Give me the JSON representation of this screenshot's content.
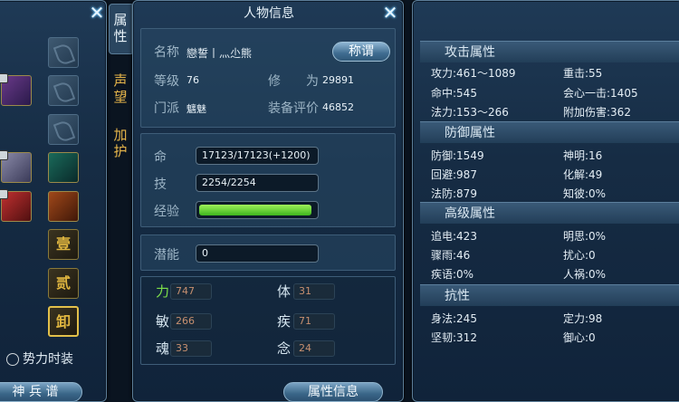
{
  "equipment": {
    "close_glyph": "✕",
    "runes": [
      "壹",
      "贰",
      "卸"
    ],
    "checkbox_label": "势力时装",
    "bottom_button": "神 兵 谱"
  },
  "tabs": {
    "attr": "属性",
    "fame": "声望",
    "protect": "加护"
  },
  "info": {
    "title": "人物信息",
    "close_glyph": "✕",
    "name_label": "名称",
    "name_value": "戀誓丨灬尐熊",
    "title_button": "称谓",
    "level_label": "等级",
    "level_value": "76",
    "xiu_label": "修",
    "wei_label": "为",
    "xiu_value": "29891",
    "sect_label": "门派",
    "sect_value": "魑魅",
    "rating_label": "装备评价",
    "rating_value": "46852",
    "hp_label": "命",
    "hp_value": "17123/17123(+1200)",
    "skill_label": "技",
    "skill_value": "2254/2254",
    "exp_label": "经验",
    "exp_fraction": 0.97,
    "potential_label": "潜能",
    "potential_value": "0",
    "stats": [
      {
        "label": "力",
        "value": "747"
      },
      {
        "label": "体",
        "value": "31"
      },
      {
        "label": "敏",
        "value": "266"
      },
      {
        "label": "疾",
        "value": "71"
      },
      {
        "label": "魂",
        "value": "33"
      },
      {
        "label": "念",
        "value": "24"
      }
    ],
    "bottom_button": "属性信息"
  },
  "props": {
    "attack_head": "攻击属性",
    "attack": [
      "攻力:461～1089",
      "重击:55",
      "命中:545",
      "会心一击:1405",
      "法力:153～266",
      "附加伤害:362"
    ],
    "defense_head": "防御属性",
    "defense": [
      "防御:1549",
      "神明:16",
      "回避:987",
      "化解:49",
      "法防:879",
      "知彼:0%"
    ],
    "advanced_head": "高级属性",
    "advanced": [
      "追电:423",
      "明思:0%",
      "骤雨:46",
      "扰心:0",
      "疾语:0%",
      "人祸:0%"
    ],
    "resist_head": "抗性",
    "resist": [
      "身法:245",
      "定力:98",
      "坚韧:312",
      "御心:0"
    ]
  },
  "colors": {
    "accent_green": "#3db51e",
    "gold": "#e6b54a"
  }
}
